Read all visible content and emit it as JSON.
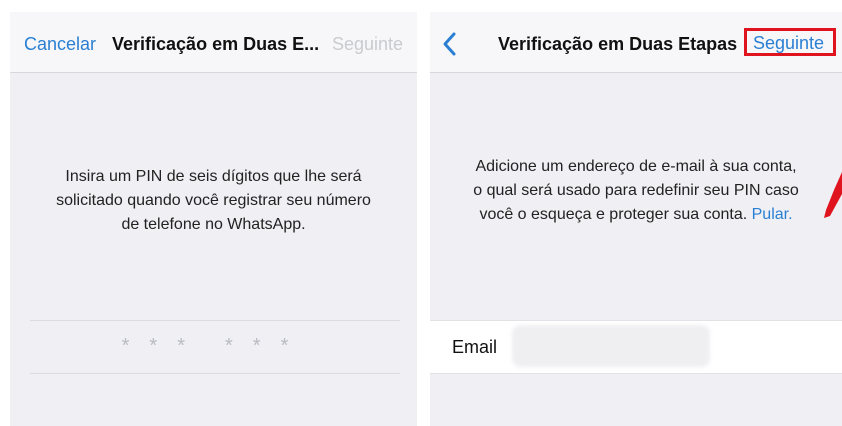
{
  "left_screen": {
    "nav": {
      "cancel": "Cancelar",
      "title": "Verificação em Duas E...",
      "next": "Seguinte"
    },
    "instructions": [
      "Insira um PIN de seis dígitos que lhe será",
      "solicitado quando você registrar seu número",
      "de telefone no WhatsApp."
    ],
    "pin_placeholder": [
      "*",
      "*",
      "*",
      "*",
      "*",
      "*"
    ]
  },
  "right_screen": {
    "nav": {
      "back_icon": "chevron-left-icon",
      "title": "Verificação em Duas Etapas",
      "next": "Seguinte"
    },
    "instructions": [
      "Adicione um endereço de e-mail à sua conta,",
      "o qual será usado para redefinir seu PIN caso",
      "você o esqueça e proteger sua conta."
    ],
    "skip_link": "Pular.",
    "email_label": "Email",
    "email_value": ""
  },
  "colors": {
    "ios_blue": "#2a7fd3",
    "disabled_gray": "#c9cbd0",
    "highlight_red": "#e0141e",
    "background": "#efeff4"
  }
}
